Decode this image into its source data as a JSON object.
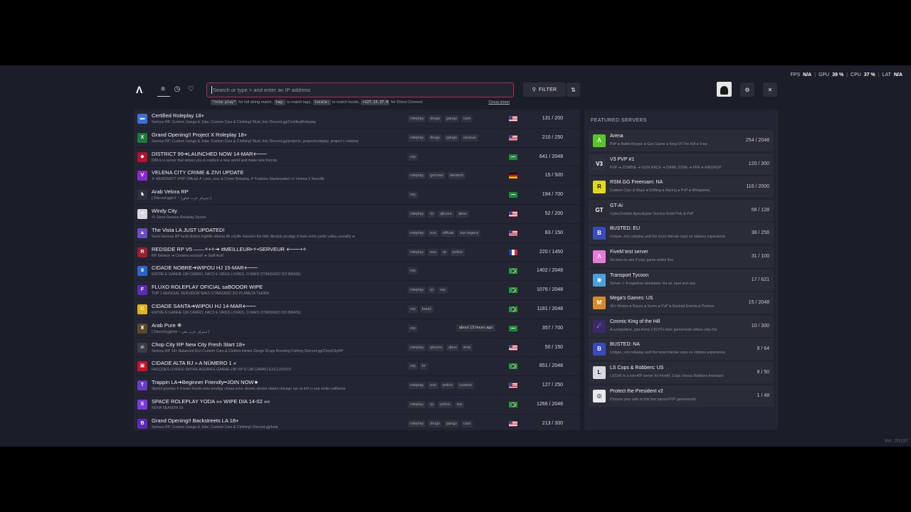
{
  "perf": {
    "fps_label": "FPS",
    "fps_value": "N/A",
    "gpu_label": "GPU",
    "gpu_value": "39 %",
    "cpu_label": "CPU",
    "cpu_value": "37 %",
    "lat_label": "LAT",
    "lat_value": "N/A",
    "sep": "|"
  },
  "header": {
    "logo_glyph": "Λ",
    "list_icon": "≡",
    "history_icon": "◷",
    "favorite_icon": "♡",
    "search_placeholder": "Search or type > and enter an IP address",
    "filter_label": "FILTER",
    "filter_icon": "⚲",
    "sort_icon": "⇅",
    "settings_icon": "⚙",
    "close_icon": "✕"
  },
  "hint": {
    "code1": "\"role play\"",
    "text1": "for full string match,",
    "code2": "tag:",
    "text2": "to match tags,",
    "code3": "locale:",
    "text3": "to match locale,",
    "code4": ">127.13.37.0",
    "text4": "for Direct Connect",
    "cheat": "Cheat sheet"
  },
  "servers": [
    {
      "name": "Certified Roleplay 18+",
      "desc": "Serious RP, Custom Gangs & Jobs, Custom Cars & Clothing! Must Join Discord.gg/CertifiedRoleplay",
      "tags": [
        "roleplay",
        "drugs",
        "gangs",
        "cars"
      ],
      "flag": "us",
      "players": "131 / 200",
      "icon_color": "#3a6fd8",
      "icon_text": "▬"
    },
    {
      "name": "Grand Opening!! Project X Roleplay 18+",
      "desc": "Serious RP, Custom Gangs & Jobs, Custom Cars & Clothing! Must Join Discord.gg/projectx, projectxroleplay, project x roleplay",
      "tags": [
        "roleplay",
        "drugs",
        "gangs",
        "serious"
      ],
      "flag": "us",
      "players": "210 / 250",
      "icon_color": "#1c7a3c",
      "icon_text": "X"
    },
    {
      "name": "DISTRICT 99➔LAUNCHED NOW 14-MAR🡐",
      "desc": "D99 is a server that allows you to explore a new world and make new friends",
      "tags": [
        "vrp"
      ],
      "flag": "sa",
      "players": "641 / 2048",
      "icon_color": "#b3122a",
      "icon_text": "◆"
    },
    {
      "name": "VELENA CITY CRIME & ZIVI UPDATE",
      "desc": "✗ HEADSHOT ✗RP-Official ✗ Love, Lies & Crime Roleplay ✗ Fraktion-Starterpaket >> Velena X Nexville",
      "tags": [
        "roleplay",
        "german",
        "deutsch"
      ],
      "flag": "de",
      "players": "15 / 500",
      "icon_color": "#8a2bc9",
      "icon_text": "V"
    },
    {
      "name": "Arab Velora RP",
      "desc": "[ Discord.gg/v1 ~ سيرفر عرب فيلورا ]",
      "tags": [
        "vrp"
      ],
      "flag": "sa",
      "players": "194 / 700",
      "icon_color": "#2d3140",
      "icon_text": "♞"
    },
    {
      "name": "Windy City",
      "desc": "#1 Semi-Serious Roleplay Server",
      "tags": [
        "roleplay",
        "rp",
        "qbcore",
        "qbox"
      ],
      "flag": "us",
      "players": "52 / 200",
      "icon_color": "#d8d8de",
      "icon_text": "✶"
    },
    {
      "name": "The Vista LA JUST UPDATED!",
      "desc": "Semi-Serious RP lucid district highlife atlanta tfb citylife houston the hills lifestyle prodigy d town echo yardz valley sociality w",
      "tags": [
        "roleplay",
        "esx",
        "official",
        "esx legacy"
      ],
      "flag": "us",
      "players": "83 / 150",
      "icon_color": "#6a4cc4",
      "icon_text": "▲"
    },
    {
      "name": "REDSIDE RP V5 ——✧•✧➔ #MEILLEUR•✧•SERVEUR 🡐•✧",
      "desc": "RP Sérieux ➔ Contenu exclusif ➔ Staff Actif",
      "tags": [
        "roleplay",
        "esx",
        "rp",
        "police"
      ],
      "flag": "fr",
      "players": "220 / 1450",
      "icon_color": "#9a1e2e",
      "icon_text": "R"
    },
    {
      "name": "CIDADE NOBRE➔WIPOU HJ 15-MAR🡐",
      "desc": "ENTRE E GANHE UM CARRO, FACS E ORGS LIVRES, O MAIS OTIMIZADO DO BRASIL",
      "tags": [
        "vrp"
      ],
      "flag": "br",
      "players": "1402 / 2048",
      "icon_color": "#2f63c9",
      "icon_text": "♛"
    },
    {
      "name": "FLUXO ROLEPLAY OFICIAL saBOOOR WIPE",
      "desc": "TOP 1 MUNDIAL SERVIDOR MAIS OTIMIZADO DO PLANETA TERRA",
      "tags": [
        "roleplay",
        "rp",
        "vrp"
      ],
      "flag": "br",
      "players": "1076 / 2048",
      "icon_color": "#5a2bb8",
      "icon_text": "F"
    },
    {
      "name": "CIDADE SANTA➔WIPOU HJ 14-MAR🡐",
      "desc": "ENTRE E GANHE UM CARRO, FACS E ORGS LIVRES, O MAIS OTIMIZADO DO BRASIL",
      "tags": [
        "vrp",
        "brasil"
      ],
      "flag": "br",
      "players": "1181 / 2048",
      "icon_color": "#e0b21c",
      "icon_text": "C"
    },
    {
      "name": "Arab Pure ❄",
      "desc": "[ Discord.gg/mk ~ سيرفر عرب نقي ]",
      "tags": [
        "vrp"
      ],
      "flag": "sa",
      "players": "357 / 700",
      "icon_color": "#5a4a2a",
      "icon_text": "♜",
      "ago": "about 19 hours ago"
    },
    {
      "name": "Chop City RP New City Fresh Start 18+",
      "desc": "Serious RP 18+ Balanced Eco Custom Cars & Clothes Heists Gangs Drugs Boosting Fishing Discord.gg/ChopCityRP",
      "tags": [
        "roleplay",
        "qbcore",
        "qbox",
        "ems"
      ],
      "flag": "us",
      "players": "50 / 150",
      "icon_color": "#3a3c48",
      "icon_text": "☠"
    },
    {
      "name": "CIDADE ALTA RJ » A NÚMERO 1 «",
      "desc": "FACÇÕES LIVRES! ENTRE AGORA E GANHE UM VIP E UM CARRO EXCLUSIVO!",
      "tags": [
        "vrp",
        "br"
      ],
      "flag": "br",
      "players": "851 / 2048",
      "icon_color": "#c8142a",
      "icon_text": "▣"
    },
    {
      "name": "Trappin LA➔Beginner Friendly━JOIN NOW★",
      "desc": "district grizzley h d town hoods pma prodigy chiraq echo streets stories miami chicago nyc la tmf cr pvp smile california",
      "tags": [
        "roleplay",
        "esx",
        "police",
        "custom"
      ],
      "flag": "us",
      "players": "127 / 250",
      "icon_color": "#6a3cc4",
      "icon_text": "T"
    },
    {
      "name": "SPACE ROLEPLAY YODA »» WIPE DIA 14-02 ««",
      "desc": "NOVA SEASON 19",
      "tags": [
        "roleplay",
        "rp",
        "police",
        "vrp"
      ],
      "flag": "br",
      "players": "1266 / 2048",
      "icon_color": "#7a3cd8",
      "icon_text": "S"
    },
    {
      "name": "Grand Opening!! Backstreets LA 18+",
      "desc": "Serious RP, Custom Gangs & Jobs, Custom Cars & Clothing! Discord.gg/bsla",
      "tags": [
        "roleplay",
        "drugs",
        "gangs",
        "cars"
      ],
      "flag": "us",
      "players": "213 / 300",
      "icon_color": "#5a2bb8",
      "icon_text": "B"
    }
  ],
  "featured": {
    "title": "FEATURED SERVERS",
    "items": [
      {
        "name": "Arena",
        "desc": "PvP ● Battle Royale ● Gun Game ● King Of The Hill ● Free",
        "players": "254 / 2048",
        "icon_color": "#5bc42a",
        "icon_text": "Λ"
      },
      {
        "name": "V3 PVP #1",
        "desc": "PVP ➔ ZOMBIE ➔ GUN RACE ➔ DARK ZONE ➔ FFA ➔ AIRDROP",
        "players": "120 / 300",
        "icon_color": "#2d3140",
        "icon_text": "V3"
      },
      {
        "name": "RSM.GG Freeroam: NA",
        "desc": "Custom Cars & Maps ● Drifting ● Racing ● PvP ● Minigames",
        "players": "116 / 2000",
        "icon_color": "#e0d81c",
        "icon_text": "R"
      },
      {
        "name": "GT-Ai",
        "desc": "CyberZombie Apocalypse Survive Build PvE & PvP",
        "players": "56 / 128",
        "icon_color": "#2a2c34",
        "icon_text": "GT"
      },
      {
        "name": "BUSTED: EU",
        "desc": "Unique, non roleplay and the most intense cops vs robbers experience",
        "players": "38 / 256",
        "icon_color": "#3a4ab8",
        "icon_text": "B"
      },
      {
        "name": "FiveM test server",
        "desc": "Go here to see if your game works fine",
        "players": "31 / 100",
        "icon_color": "#e87ad8",
        "icon_text": "Λ"
      },
      {
        "name": "Transport Tycoon",
        "desc": "Server 1: A logistical simulation Via air, land and sea",
        "players": "17 / 621",
        "icon_color": "#4aa0d8",
        "icon_text": "◉"
      },
      {
        "name": "Mega's Games: US",
        "desc": "40+ Modes ● Races ● Sumo ● PvP ● Ranked Events ● Parkour",
        "players": "15 / 2048",
        "icon_color": "#d88a2a",
        "icon_text": "M"
      },
      {
        "name": "Cosmic King of the Hill",
        "desc": "A competitive, pvp Arma 3 KOTH style gamemode where only the",
        "players": "10 / 300",
        "icon_color": "#3a2a6a",
        "icon_text": "☄"
      },
      {
        "name": "BUSTED: NA",
        "desc": "Unique, non roleplay and the most intense cops vs robbers experience",
        "players": "9 / 64",
        "icon_color": "#3a4ab8",
        "icon_text": "B"
      },
      {
        "name": "LS Cops & Robbers: US",
        "desc": "LSCnR is a non-RP server for FiveM. Cops Versus Robbers freeroam",
        "players": "8 / 50",
        "icon_color": "#d8d8de",
        "icon_text": "L"
      },
      {
        "name": "Protect the President v2",
        "desc": "Choose your side in this fast paced PVP gamemode!",
        "players": "1 / 48",
        "icon_color": "#e8e8ee",
        "icon_text": "◎"
      }
    ]
  },
  "version": "Ver. 26197"
}
